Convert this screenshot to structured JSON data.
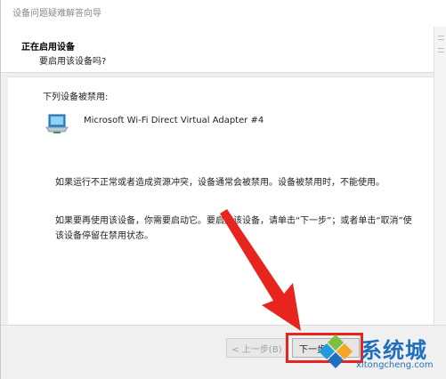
{
  "window": {
    "title": "设备问题疑难解答向导"
  },
  "header": {
    "title": "正在启用设备",
    "subtitle": "要启用该设备吗?"
  },
  "content": {
    "disabled_label": "下列设备被禁用:",
    "device_name": "Microsoft Wi-Fi Direct Virtual Adapter #4",
    "paragraph1": "如果运行不正常或者造成资源冲突，设备通常会被禁用。设备被禁用时，不能使用。",
    "paragraph2": "如果要再使用该设备，你需要启动它。要启用该设备，请单击“下一步”；或者单击“取消”使该设备停留在禁用状态。"
  },
  "footer": {
    "back_label": "< 上一步(B)",
    "next_label": "下一步"
  },
  "watermark": {
    "brand": "系统城",
    "url": "xitongcheng.com"
  },
  "colors": {
    "annotation_red": "#e8241f",
    "watermark_blue": "#1e6fbf"
  },
  "icons": [
    "network-adapter-icon",
    "annotation-arrow",
    "watermark-logo-icon"
  ]
}
